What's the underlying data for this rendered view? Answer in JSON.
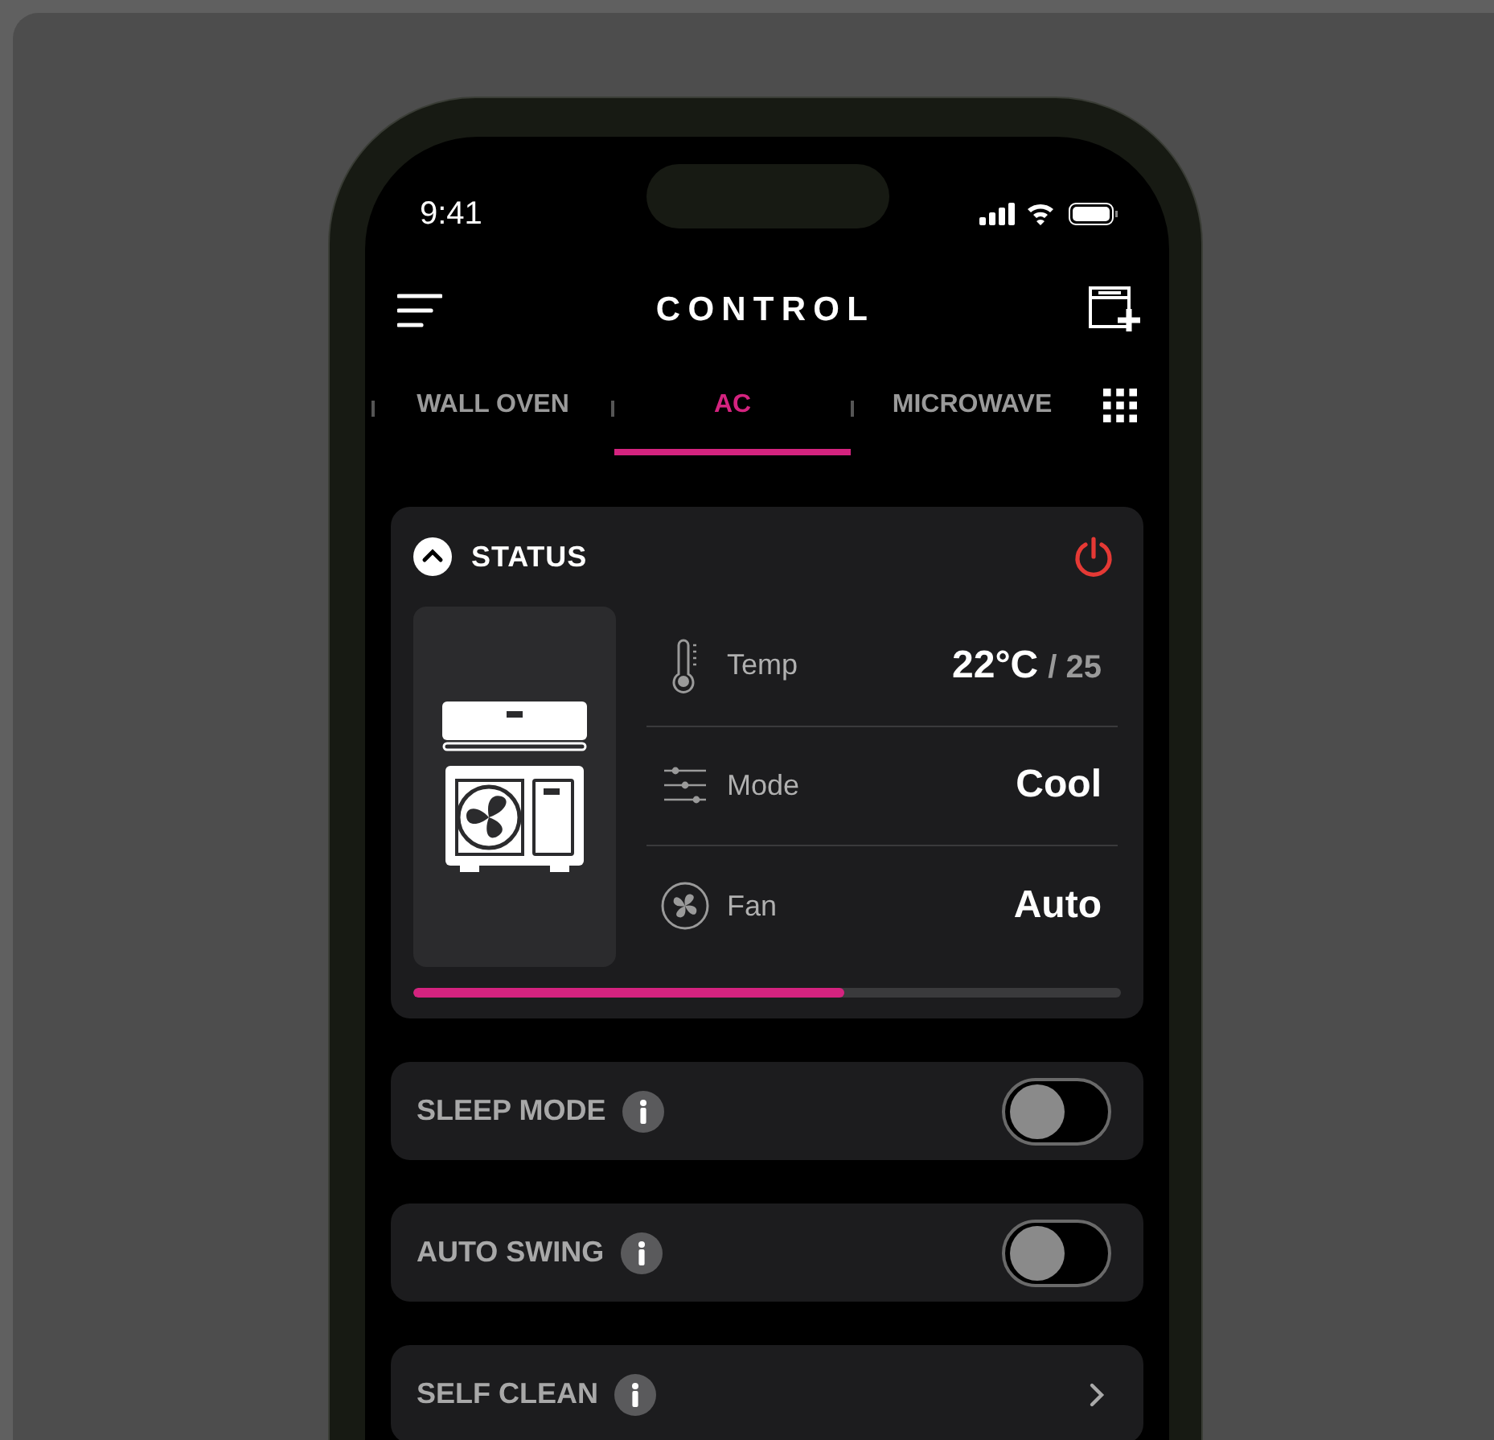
{
  "status_bar": {
    "time": "9:41"
  },
  "header": {
    "title": "CONTROL"
  },
  "tabs": [
    {
      "label": "WALL OVEN",
      "selected": false
    },
    {
      "label": "AC",
      "selected": true
    },
    {
      "label": "MICROWAVE",
      "selected": false
    }
  ],
  "status_card": {
    "title": "STATUS",
    "expanded": true,
    "power_on": true,
    "rows": [
      {
        "kind": "temp",
        "label": "Temp",
        "value": "22°C",
        "target": "/ 25"
      },
      {
        "kind": "mode",
        "label": "Mode",
        "value": "Cool"
      },
      {
        "kind": "fan",
        "label": "Fan",
        "value": "Auto"
      }
    ],
    "progress": {
      "level": 0.61
    }
  },
  "settings": [
    {
      "kind": "toggle",
      "label": "SLEEP MODE",
      "on": false
    },
    {
      "kind": "toggle",
      "label": "AUTO SWING",
      "on": false
    },
    {
      "kind": "link",
      "label": "SELF CLEAN"
    }
  ]
}
